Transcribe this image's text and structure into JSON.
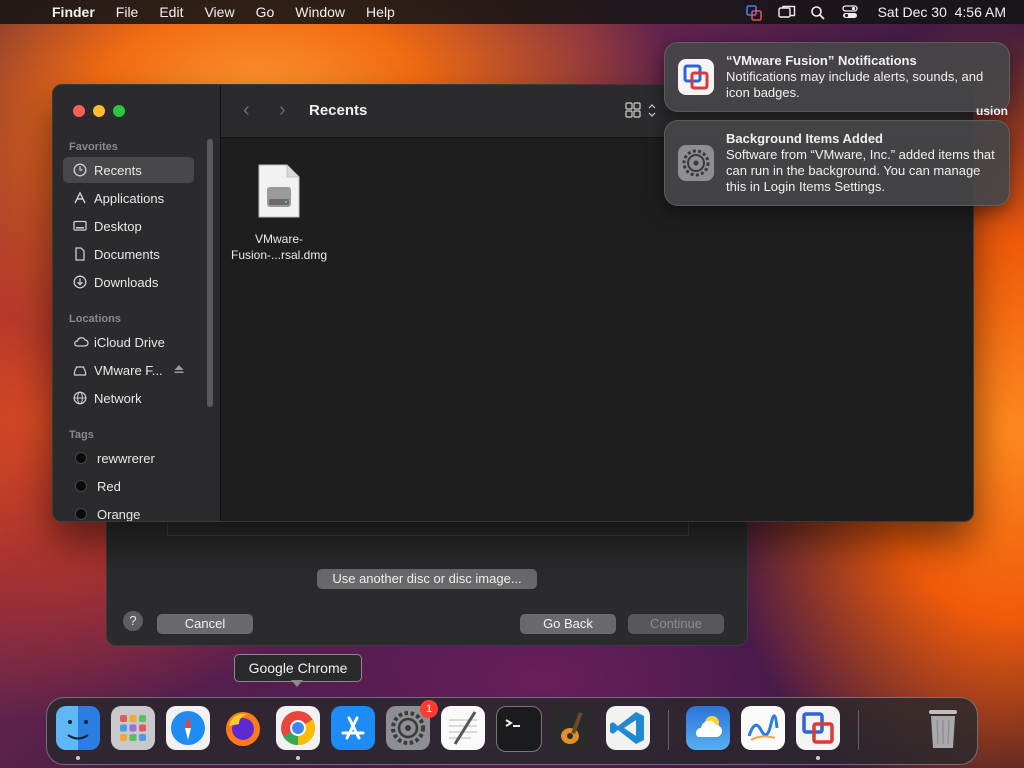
{
  "menubar": {
    "app_name": "Finder",
    "items": [
      "File",
      "Edit",
      "View",
      "Go",
      "Window",
      "Help"
    ],
    "datetime": "Sat Dec 30  4:56 AM"
  },
  "finder": {
    "title": "Recents",
    "sidebar": {
      "favorites_heading": "Favorites",
      "favorites": [
        {
          "label": "Recents",
          "icon": "clock-icon",
          "selected": true
        },
        {
          "label": "Applications",
          "icon": "applications-icon"
        },
        {
          "label": "Desktop",
          "icon": "desktop-icon"
        },
        {
          "label": "Documents",
          "icon": "document-icon"
        },
        {
          "label": "Downloads",
          "icon": "download-icon"
        }
      ],
      "locations_heading": "Locations",
      "locations": [
        {
          "label": "iCloud Drive",
          "icon": "cloud-icon"
        },
        {
          "label": "VMware F...",
          "icon": "disk-icon"
        },
        {
          "label": "Network",
          "icon": "globe-icon"
        }
      ],
      "tags_heading": "Tags",
      "tags": [
        {
          "label": "rewwrerer"
        },
        {
          "label": "Red"
        },
        {
          "label": "Orange"
        }
      ]
    },
    "files": [
      {
        "name_line1": "VMware-",
        "name_line2": "Fusion-...rsal.dmg",
        "icon": "disk-image-icon"
      }
    ]
  },
  "installer": {
    "use_another_label": "Use another disc or disc image...",
    "cancel_label": "Cancel",
    "go_back_label": "Go Back",
    "continue_label": "Continue",
    "help_label": "?"
  },
  "notifications": [
    {
      "title": "“VMware Fusion” Notifications",
      "body": "Notifications may include alerts, sounds, and icon badges.",
      "icon": "vmware-fusion-icon"
    },
    {
      "title": "Background Items Added",
      "body": "Software from “VMware, Inc.” added items that can run in the background. You can manage this in Login Items Settings.",
      "icon": "gear-icon"
    }
  ],
  "partial_text": "usion",
  "tooltip": "Google Chrome",
  "dock": {
    "apps": [
      {
        "name": "finder-icon"
      },
      {
        "name": "launchpad-icon"
      },
      {
        "name": "safari-icon"
      },
      {
        "name": "firefox-icon"
      },
      {
        "name": "chrome-icon"
      },
      {
        "name": "app-store-icon"
      },
      {
        "name": "system-settings-icon",
        "badge": "1"
      },
      {
        "name": "textedit-icon"
      },
      {
        "name": "terminal-icon"
      },
      {
        "name": "garageband-icon"
      },
      {
        "name": "vscode-icon"
      },
      {
        "name": "weather-icon"
      },
      {
        "name": "freeform-icon"
      },
      {
        "name": "vmware-fusion-icon"
      },
      {
        "name": "trash-icon"
      }
    ]
  },
  "colors": {
    "red_light": "#ff5f57",
    "yellow_light": "#febc2e",
    "green_light": "#28c840",
    "badge": "#ff3b30"
  }
}
